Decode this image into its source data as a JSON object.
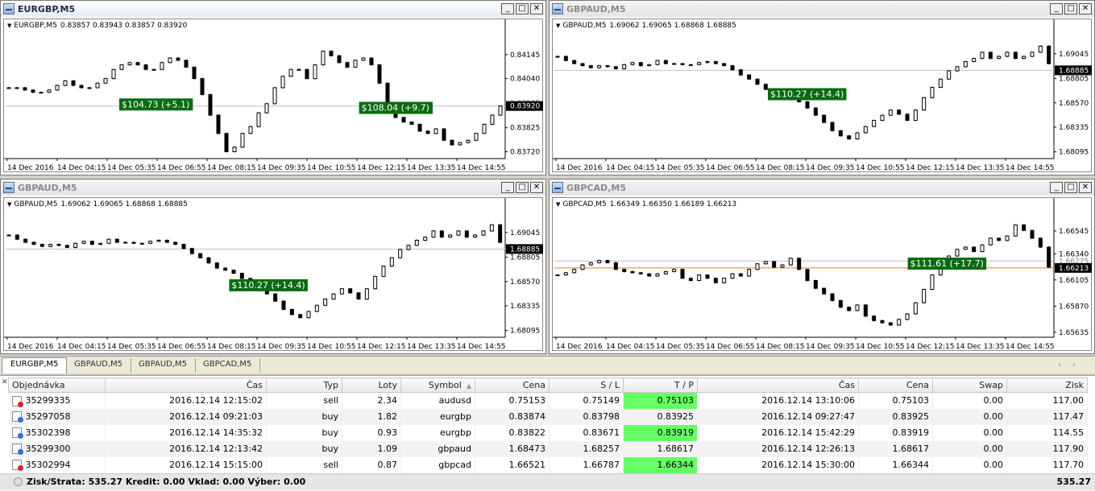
{
  "charts": [
    {
      "id": "c0",
      "title": "EURGBP,M5",
      "active": true,
      "header": {
        "symbol": "EURGBP,M5",
        "ohlc": "0.83857 0.83943 0.83857 0.83920"
      },
      "y_ticks": [
        "0.84145",
        "0.84040",
        "0.83825",
        "0.83720"
      ],
      "y_ticks_vals": [
        0.84145,
        0.8404,
        0.83825,
        0.8372
      ],
      "ylim": [
        0.8369,
        0.8425
      ],
      "bid_label": "0.83920",
      "bid": 0.8392,
      "ghost_label": "0.83935",
      "ghost": 0.83935,
      "x_ticks": [
        "14 Dec 2016",
        "14 Dec 04:15",
        "14 Dec 05:35",
        "14 Dec 06:55",
        "14 Dec 08:15",
        "14 Dec 09:35",
        "14 Dec 10:55",
        "14 Dec 12:15",
        "14 Dec 13:35",
        "14 Dec 14:55"
      ],
      "series": [
        0.84,
        0.84,
        0.8399,
        0.8398,
        0.8398,
        0.8399,
        0.8401,
        0.8403,
        0.8401,
        0.84,
        0.84,
        0.8402,
        0.8404,
        0.8408,
        0.841,
        0.8411,
        0.841,
        0.8408,
        0.8408,
        0.8411,
        0.8413,
        0.8412,
        0.8409,
        0.8404,
        0.8397,
        0.8388,
        0.838,
        0.8372,
        0.8374,
        0.838,
        0.8383,
        0.8389,
        0.8393,
        0.84,
        0.8405,
        0.8408,
        0.8408,
        0.8404,
        0.841,
        0.8416,
        0.8414,
        0.8411,
        0.8409,
        0.8412,
        0.8413,
        0.841,
        0.8402,
        0.8392,
        0.8387,
        0.8385,
        0.8384,
        0.8381,
        0.838,
        0.8382,
        0.8377,
        0.8375,
        0.8376,
        0.8377,
        0.838,
        0.8384,
        0.8388,
        0.8392
      ],
      "labels": [
        {
          "text": "$104.73 (+5.1)",
          "price": 0.83925,
          "at": 0.3
        },
        {
          "text": "$108.04 (+9.7)",
          "price": 0.8391,
          "at": 0.78
        }
      ]
    },
    {
      "id": "c1",
      "title": "GBPAUD,M5",
      "active": false,
      "header": {
        "symbol": "GBPAUD,M5",
        "ohlc": "1.69062 1.69065 1.68868 1.68885"
      },
      "y_ticks": [
        "1.69045",
        "1.68805",
        "1.68570",
        "1.68335",
        "1.68095"
      ],
      "y_ticks_vals": [
        1.69045,
        1.68805,
        1.6857,
        1.68335,
        1.68095
      ],
      "ylim": [
        1.6803,
        1.6927
      ],
      "bid_label": "1.68885",
      "bid": 1.68885,
      "ghost_label": "",
      "ghost": 0,
      "x_ticks": [
        "14 Dec 2016",
        "14 Dec 04:15",
        "14 Dec 05:35",
        "14 Dec 06:55",
        "14 Dec 08:15",
        "14 Dec 09:35",
        "14 Dec 10:55",
        "14 Dec 12:15",
        "14 Dec 13:35",
        "14 Dec 14:55"
      ],
      "series": [
        1.6902,
        1.6898,
        1.6895,
        1.6893,
        1.6891,
        1.6893,
        1.6892,
        1.689,
        1.6894,
        1.6896,
        1.6893,
        1.6894,
        1.6898,
        1.6895,
        1.6895,
        1.6894,
        1.6894,
        1.6896,
        1.6897,
        1.6895,
        1.6893,
        1.6889,
        1.6884,
        1.688,
        1.6875,
        1.687,
        1.6868,
        1.6865,
        1.686,
        1.6858,
        1.6852,
        1.6845,
        1.6838,
        1.683,
        1.6825,
        1.6822,
        1.6828,
        1.6834,
        1.684,
        1.6845,
        1.685,
        1.6846,
        1.684,
        1.685,
        1.6862,
        1.6872,
        1.688,
        1.6888,
        1.6892,
        1.6897,
        1.69,
        1.6906,
        1.69,
        1.6902,
        1.6906,
        1.69,
        1.6902,
        1.6906,
        1.6912,
        1.6895
      ],
      "labels": [
        {
          "text": "$110.27 (+14.4)",
          "price": 1.6865,
          "at": 0.5
        }
      ]
    },
    {
      "id": "c2",
      "title": "GBPAUD,M5",
      "active": false,
      "header": {
        "symbol": "GBPAUD,M5",
        "ohlc": "1.69062 1.69065 1.68868 1.68885"
      },
      "y_ticks": [
        "1.69045",
        "1.68805",
        "1.68570",
        "1.68335",
        "1.68095"
      ],
      "y_ticks_vals": [
        1.69045,
        1.68805,
        1.6857,
        1.68335,
        1.68095
      ],
      "ylim": [
        1.6803,
        1.6927
      ],
      "bid_label": "1.68885",
      "bid": 1.68885,
      "ghost_label": "",
      "ghost": 0,
      "x_ticks": [
        "14 Dec 2016",
        "14 Dec 04:15",
        "14 Dec 05:35",
        "14 Dec 06:55",
        "14 Dec 08:15",
        "14 Dec 09:35",
        "14 Dec 10:55",
        "14 Dec 12:15",
        "14 Dec 13:35",
        "14 Dec 14:55"
      ],
      "series": [
        1.6902,
        1.6898,
        1.6895,
        1.6893,
        1.6891,
        1.6893,
        1.6892,
        1.689,
        1.6894,
        1.6896,
        1.6893,
        1.6894,
        1.6898,
        1.6895,
        1.6895,
        1.6894,
        1.6894,
        1.6896,
        1.6897,
        1.6895,
        1.6893,
        1.6889,
        1.6884,
        1.688,
        1.6875,
        1.687,
        1.6868,
        1.6865,
        1.686,
        1.6858,
        1.6852,
        1.6845,
        1.6838,
        1.683,
        1.6825,
        1.6822,
        1.6828,
        1.6834,
        1.684,
        1.6845,
        1.685,
        1.6846,
        1.684,
        1.685,
        1.6862,
        1.6872,
        1.688,
        1.6888,
        1.6892,
        1.6897,
        1.69,
        1.6906,
        1.69,
        1.6902,
        1.6906,
        1.69,
        1.6902,
        1.6906,
        1.6912,
        1.6895
      ],
      "labels": [
        {
          "text": "$110.27 (+14.4)",
          "price": 1.6853,
          "at": 0.52
        }
      ]
    },
    {
      "id": "c3",
      "title": "GBPCAD,M5",
      "active": false,
      "header": {
        "symbol": "GBPCAD,M5",
        "ohlc": "1.66349 1.66350 1.66189 1.66213"
      },
      "y_ticks": [
        "1.66545",
        "1.66340",
        "1.66105",
        "1.65870",
        "1.65635"
      ],
      "y_ticks_vals": [
        1.66545,
        1.6634,
        1.66105,
        1.6587,
        1.65635
      ],
      "ylim": [
        1.6559,
        1.6674
      ],
      "bid_label": "1.66213",
      "bid": 1.66213,
      "ghost_label": "1.66275",
      "ghost": 1.66275,
      "x_ticks": [
        "14 Dec 2016",
        "14 Dec 04:15",
        "14 Dec 05:35",
        "14 Dec 06:55",
        "14 Dec 08:15",
        "14 Dec 09:35",
        "14 Dec 10:55",
        "14 Dec 12:15",
        "14 Dec 13:35",
        "14 Dec 14:55"
      ],
      "series": [
        1.6615,
        1.6617,
        1.662,
        1.6624,
        1.6626,
        1.6628,
        1.6626,
        1.662,
        1.6618,
        1.6617,
        1.6616,
        1.6614,
        1.6616,
        1.6618,
        1.662,
        1.6612,
        1.661,
        1.6615,
        1.6612,
        1.6608,
        1.6612,
        1.6616,
        1.6614,
        1.662,
        1.6625,
        1.6627,
        1.6622,
        1.6624,
        1.663,
        1.662,
        1.661,
        1.6603,
        1.6598,
        1.6592,
        1.6586,
        1.6583,
        1.6588,
        1.6578,
        1.6574,
        1.6572,
        1.657,
        1.6575,
        1.658,
        1.659,
        1.6602,
        1.6615,
        1.6625,
        1.6632,
        1.6638,
        1.664,
        1.6636,
        1.6642,
        1.6648,
        1.6646,
        1.665,
        1.666,
        1.6655,
        1.6648,
        1.664,
        1.6622
      ],
      "labels": [
        {
          "text": "$111.61 (+17.7)",
          "price": 1.66248,
          "at": 0.78
        }
      ]
    }
  ],
  "tabs": [
    "EURGBP,M5",
    "GBPAUD,M5",
    "GBPAUD,M5",
    "GBPCAD,M5"
  ],
  "terminal": {
    "headers": [
      "Objednávka",
      "Čas",
      "Typ",
      "Loty",
      "Symbol",
      "Cena",
      "S / L",
      "T / P",
      "Čas",
      "Cena",
      "Swap",
      "Zisk"
    ],
    "rows": [
      {
        "order": "35299335",
        "time": "2016.12.14 12:15:02",
        "type": "sell",
        "lots": "2.34",
        "symbol": "audusd",
        "price": "0.75153",
        "sl": "0.75149",
        "tp": "0.75103",
        "close_time": "2016.12.14 13:10:06",
        "close_price": "0.75103",
        "swap": "0.00",
        "profit": "117.00"
      },
      {
        "order": "35297058",
        "time": "2016.12.14 09:21:03",
        "type": "buy",
        "lots": "1.82",
        "symbol": "eurgbp",
        "price": "0.83874",
        "sl": "0.83798",
        "tp": "0.83925",
        "close_time": "2016.12.14 09:27:47",
        "close_price": "0.83925",
        "swap": "0.00",
        "profit": "117.47"
      },
      {
        "order": "35302398",
        "time": "2016.12.14 14:35:32",
        "type": "buy",
        "lots": "0.93",
        "symbol": "eurgbp",
        "price": "0.83822",
        "sl": "0.83671",
        "tp": "0.83919",
        "close_time": "2016.12.14 15:42:29",
        "close_price": "0.83919",
        "swap": "0.00",
        "profit": "114.55"
      },
      {
        "order": "35299300",
        "time": "2016.12.14 12:13:42",
        "type": "buy",
        "lots": "1.09",
        "symbol": "gbpaud",
        "price": "1.68473",
        "sl": "1.68257",
        "tp": "1.68617",
        "close_time": "2016.12.14 12:26:13",
        "close_price": "1.68617",
        "swap": "0.00",
        "profit": "117.90"
      },
      {
        "order": "35302994",
        "time": "2016.12.14 15:15:00",
        "type": "sell",
        "lots": "0.87",
        "symbol": "gbpcad",
        "price": "1.66521",
        "sl": "1.66787",
        "tp": "1.66344",
        "close_time": "2016.12.14 15:30:00",
        "close_price": "1.66344",
        "swap": "0.00",
        "profit": "117.70"
      }
    ],
    "status": "Zisk/Strata: 535.27  Kredit: 0.00  Vklad: 0.00  Výber: 0.00",
    "total": "535.27"
  },
  "colors": {
    "label_bg": "#0b6b12",
    "tp_bg": "#66ff66",
    "bid_bg": "#000000",
    "sell_icon": "#e02020",
    "buy_icon": "#2a6fd6"
  },
  "icons": {
    "window": "chart-window-icon",
    "minimize": "minimize-icon",
    "maximize": "maximize-icon",
    "close": "close-icon",
    "sell": "sell-order-icon",
    "buy": "buy-order-icon"
  }
}
